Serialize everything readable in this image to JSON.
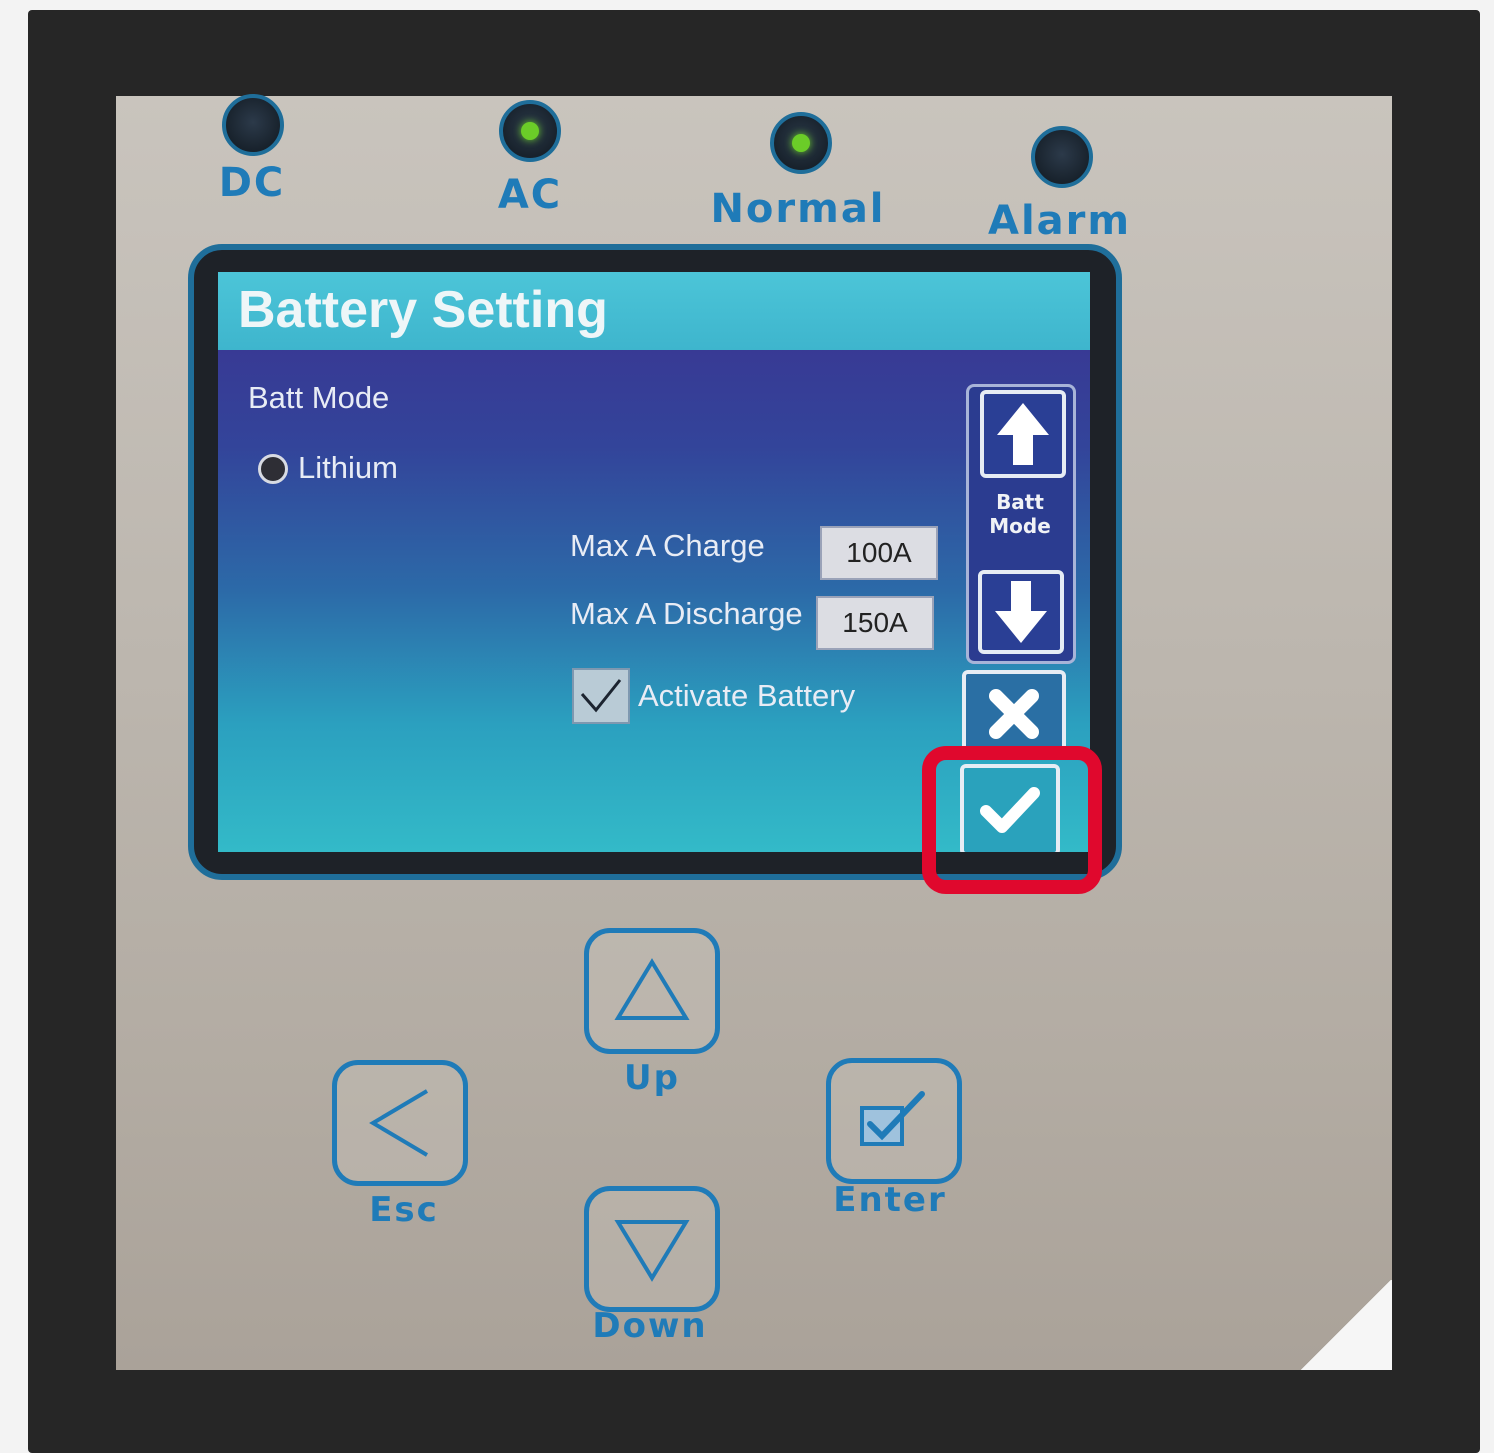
{
  "indicators": [
    {
      "label": "DC",
      "state": "off"
    },
    {
      "label": "AC",
      "state": "on"
    },
    {
      "label": "Normal",
      "state": "on"
    },
    {
      "label": "Alarm",
      "state": "off"
    }
  ],
  "screen": {
    "title": "Battery Setting",
    "batt_mode_label": "Batt Mode",
    "mode_option": "Lithium",
    "max_charge_label": "Max A Charge",
    "max_charge_value": "100A",
    "max_discharge_label": "Max A Discharge",
    "max_discharge_value": "150A",
    "activate_label": "Activate Battery",
    "activate_checked": true,
    "side_label_line1": "Batt",
    "side_label_line2": "Mode"
  },
  "keypad": {
    "up": "Up",
    "esc": "Esc",
    "enter": "Enter",
    "down": "Down"
  },
  "colors": {
    "accent_blue": "#1f7bb8",
    "led_green": "#6bcc28",
    "highlight_red": "#e0082d"
  },
  "icons": [
    "arrow-up-icon",
    "arrow-down-icon",
    "close-icon",
    "check-icon",
    "triangle-up-icon",
    "chevron-left-icon",
    "checkbox-pen-icon",
    "triangle-down-icon"
  ]
}
